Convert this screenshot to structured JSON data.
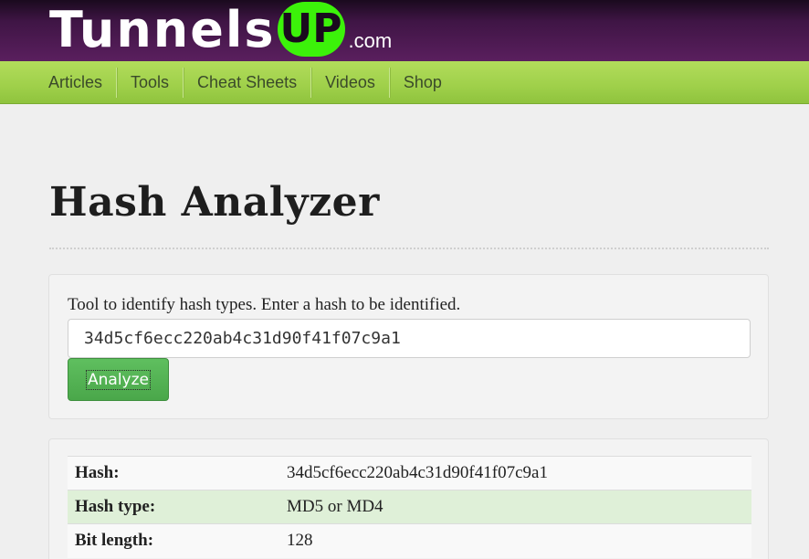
{
  "header": {
    "logo_main": "Tunnels",
    "logo_badge": "UP",
    "logo_suffix": ".com"
  },
  "nav": {
    "items": [
      {
        "label": "Articles"
      },
      {
        "label": "Tools"
      },
      {
        "label": "Cheat Sheets"
      },
      {
        "label": "Videos"
      },
      {
        "label": "Shop"
      }
    ]
  },
  "page": {
    "title": "Hash Analyzer"
  },
  "form": {
    "description": "Tool to identify hash types. Enter a hash to be identified.",
    "hash_value": "34d5cf6ecc220ab4c31d90f41f07c9a1",
    "analyze_label": "Analyze"
  },
  "results": {
    "rows": [
      {
        "label": "Hash:",
        "value": "34d5cf6ecc220ab4c31d90f41f07c9a1"
      },
      {
        "label": "Hash type:",
        "value": "MD5 or MD4"
      },
      {
        "label": "Bit length:",
        "value": "128"
      }
    ]
  },
  "colors": {
    "header_bg": "#5a1f5e",
    "logo_badge_bg": "#3cf20a",
    "nav_bg": "#9fd04a",
    "analyze_button_bg": "#4aa74a",
    "highlight_row_bg": "#dff0d8"
  }
}
